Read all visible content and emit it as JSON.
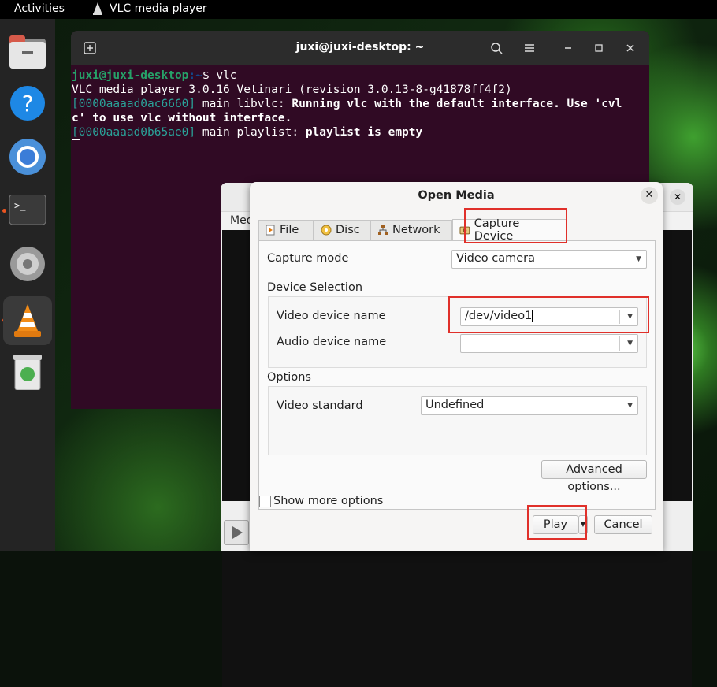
{
  "topbar": {
    "activities": "Activities",
    "app_name": "VLC media player"
  },
  "dock": {
    "items": [
      "files-icon",
      "help-icon",
      "chrome-icon",
      "terminal-icon",
      "settings-icon",
      "vlc-icon",
      "trash-icon"
    ]
  },
  "terminal": {
    "title": "juxi@juxi-desktop: ~",
    "prompt_user": "juxi@juxi-desktop",
    "prompt_path": ":~",
    "prompt_sym": "$ vlc",
    "line2": "VLC media player 3.0.16 Vetinari (revision 3.0.13-8-g41878ff4f2)",
    "line3_addr": "[0000aaaad0ac6660]",
    "line3_mod": " main libvlc: ",
    "line3_msg": "Running vlc with the default interface. Use 'cvl",
    "line4": "c' to use vlc without interface.",
    "line5_addr": "[0000aaaad0b65ae0]",
    "line5_mod": " main playlist: ",
    "line5_msg": "playlist is empty"
  },
  "behind_window": {
    "menu_fragment": "Med"
  },
  "dialog": {
    "title": "Open Media",
    "tabs": [
      {
        "label": "File",
        "accel": "F"
      },
      {
        "label": "Disc",
        "accel": "D"
      },
      {
        "label": "Network",
        "accel": "N"
      },
      {
        "label": "Capture Device",
        "accel": "C"
      }
    ],
    "capture_mode_label": "Capture mode",
    "capture_mode_value": "Video camera",
    "device_selection_label": "Device Selection",
    "video_device_label": "Video device name",
    "video_device_value": "/dev/video1",
    "audio_device_label": "Audio device name",
    "audio_device_value": "",
    "options_label": "Options",
    "video_standard_label": "Video standard",
    "video_standard_value": "Undefined",
    "advanced_button": "Advanced options...",
    "show_more_label": "Show more options",
    "play_button": "Play",
    "cancel_button": "Cancel"
  },
  "colors": {
    "highlight": "#e0302a",
    "terminal_bg": "#300a24",
    "prompt_green": "#26a269"
  }
}
